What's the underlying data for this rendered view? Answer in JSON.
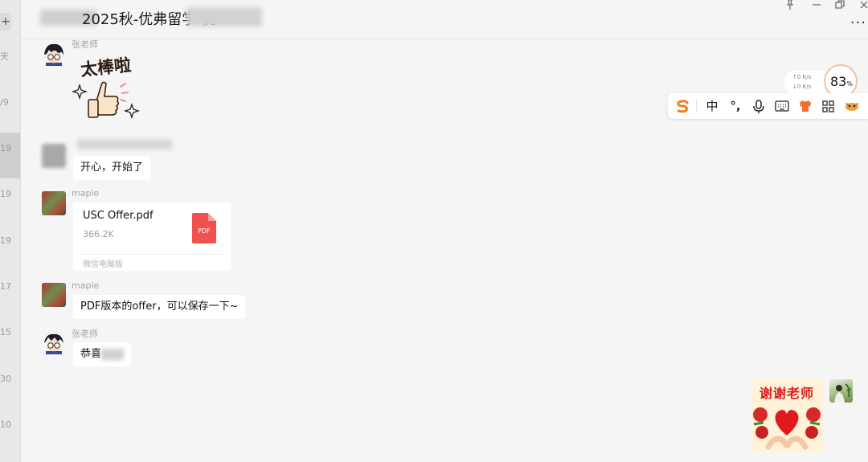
{
  "window": {
    "title": "2025秋-优弗留学-优",
    "pin_icon": "pin-icon",
    "minimize_icon": "minimize-icon",
    "restore_icon": "restore-icon",
    "close_icon": "close-icon",
    "more_icon": "more-dots-icon"
  },
  "left_strip": {
    "plus_label": "+",
    "marks": [
      "天",
      "/9",
      "19",
      "19",
      "19",
      "17",
      "15",
      "30",
      "10"
    ]
  },
  "messages": [
    {
      "sender": "张老师",
      "type": "sticker",
      "sticker_text": "太棒啦"
    },
    {
      "sender": "",
      "type": "text",
      "text": "开心，开始了"
    },
    {
      "sender": "maple",
      "type": "file",
      "file_name": "USC Offer.pdf",
      "file_size": "366.2K",
      "file_badge": "PDF",
      "source": "微信电脑版"
    },
    {
      "sender": "maple",
      "type": "text",
      "text": "PDF版本的offer，可以保存一下~"
    },
    {
      "sender": "张老师",
      "type": "text",
      "text": "恭喜"
    }
  ],
  "outgoing": {
    "sticker_text": "谢谢老师"
  },
  "ime": {
    "upload": "↑0  K/s",
    "download": "↓0  K/s",
    "gauge_value": "83",
    "gauge_unit": "%",
    "logo_icon": "sogou-s-icon",
    "mode_label": "中",
    "punct_label": "°,",
    "mic_icon": "microphone-icon",
    "keyboard_icon": "keyboard-icon",
    "skin_icon": "shirt-icon",
    "toolbox_icon": "grid-icon",
    "mascot_icon": "mascot-icon"
  },
  "colors": {
    "accent_pdf": "#f0514f",
    "ime_logo": "#f07d1a",
    "thanks_red": "#d91e1e"
  }
}
